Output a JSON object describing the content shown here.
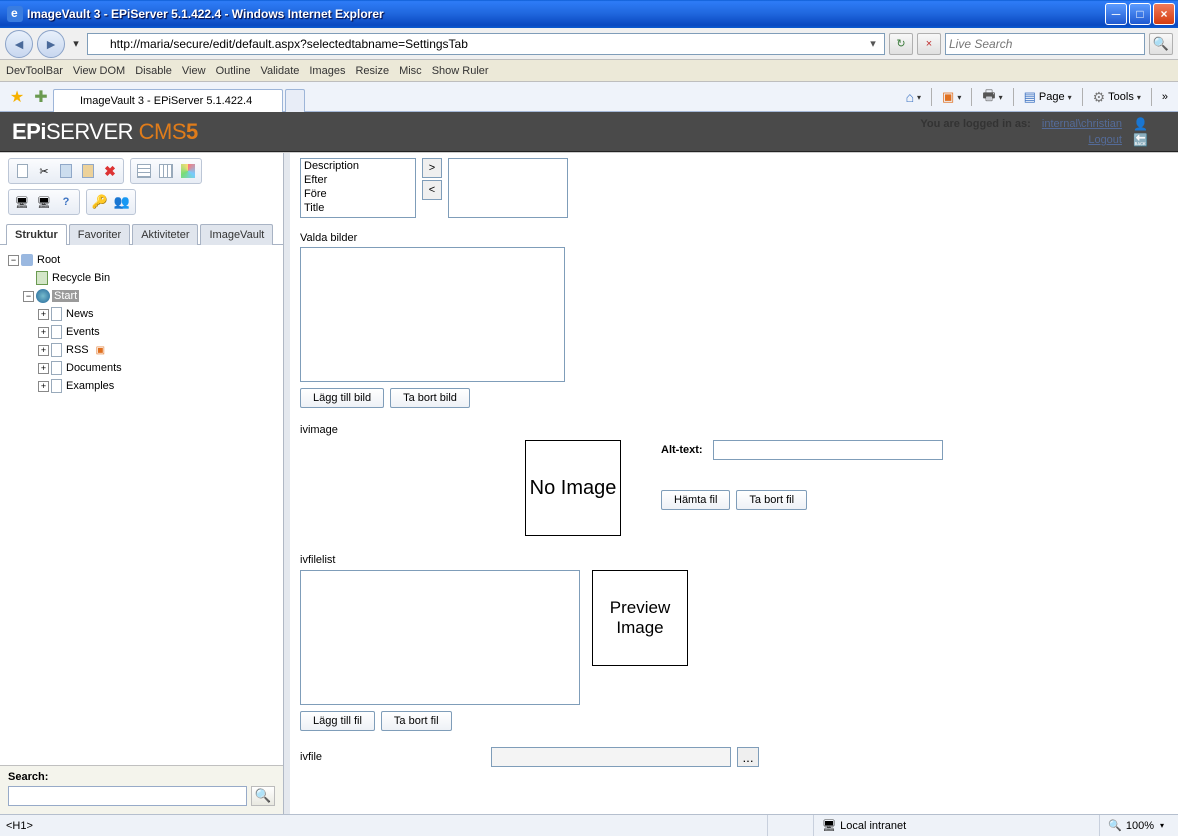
{
  "window": {
    "title": "ImageVault 3 - EPiServer 5.1.422.4 - Windows Internet Explorer"
  },
  "address": {
    "url": "http://maria/secure/edit/default.aspx?selectedtabname=SettingsTab",
    "search_placeholder": "Live Search"
  },
  "devtoolbar": [
    "DevToolBar",
    "View DOM",
    "Disable",
    "View",
    "Outline",
    "Validate",
    "Images",
    "Resize",
    "Misc",
    "Show Ruler"
  ],
  "tab": {
    "title": "ImageVault 3 - EPiServer 5.1.422.4"
  },
  "cmdbar": {
    "page": "Page",
    "tools": "Tools"
  },
  "epi": {
    "logged_in": "You are logged in as:",
    "user": "internal\\christian",
    "logout": "Logout"
  },
  "left": {
    "tabs": [
      "Struktur",
      "Favoriter",
      "Aktiviteter",
      "ImageVault"
    ],
    "tree": {
      "root": "Root",
      "recycle": "Recycle Bin",
      "start": "Start",
      "children": [
        "News",
        "Events",
        "RSS",
        "Documents",
        "Examples"
      ]
    },
    "search_label": "Search:"
  },
  "form": {
    "meta_items": [
      "Description",
      "Efter",
      "Före",
      "Title"
    ],
    "valda_label": "Valda bilder",
    "btn_add_img": "Lägg till bild",
    "btn_del_img": "Ta bort bild",
    "ivimage_label": "ivimage",
    "noimage": "No Image",
    "alt_label": "Alt-text:",
    "btn_fetch": "Hämta fil",
    "btn_remove": "Ta bort fil",
    "ivfilelist_label": "ivfilelist",
    "preview": "Preview Image",
    "btn_add_file": "Lägg till fil",
    "btn_del_file": "Ta bort fil",
    "ivfile_label": "ivfile"
  },
  "status": {
    "left": "<H1>",
    "zone": "Local intranet",
    "zoom": "100%"
  }
}
